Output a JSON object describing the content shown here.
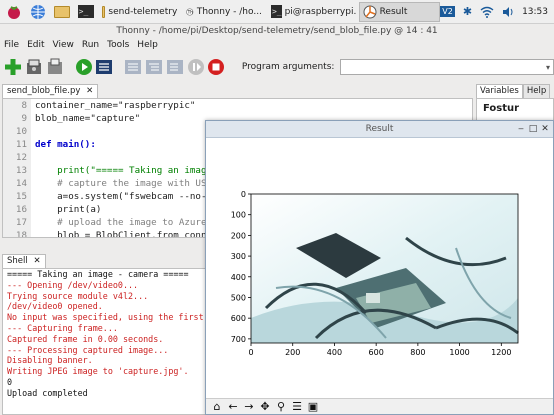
{
  "taskbar": {
    "tasks": [
      {
        "label": "send-telemetry"
      },
      {
        "label": "Thonny  - /ho..."
      },
      {
        "label": "pi@raspberrypi..."
      },
      {
        "label": "Result"
      }
    ],
    "clock": "13:53"
  },
  "window": {
    "title": "Thonny  -  /home/pi/Desktop/send-telemetry/send_blob_file.py  @  14 : 41"
  },
  "menu": {
    "items": [
      "File",
      "Edit",
      "View",
      "Run",
      "Tools",
      "Help"
    ]
  },
  "toolbar": {
    "program_args_label": "Program arguments:",
    "program_args_value": ""
  },
  "editor": {
    "tab": "send_blob_file.py",
    "line_numbers": [
      "8",
      "9",
      "10",
      "11",
      "12",
      "13",
      "14",
      "15",
      "16",
      "17",
      "18"
    ],
    "lines": [
      "container_name=\"raspberrypic\"",
      "blob_name=\"capture\"",
      "",
      "def main():",
      "",
      "    print(\"===== Taking an image",
      "    # capture the image with USB",
      "    a=os.system(\"fswebcam --no-b",
      "    print(a)",
      "    # upload the image to Azure",
      "    blob = BlobClient.from_conne"
    ]
  },
  "right_tabs": [
    "Variables",
    "Help"
  ],
  "right_panel_text": "Fostur",
  "shell": {
    "tab": "Shell",
    "lines": [
      {
        "t": "===== Taking an image - camera =====",
        "c": "blk"
      },
      {
        "t": "--- Opening /dev/video0...",
        "c": "red"
      },
      {
        "t": "Trying source module v4l2...",
        "c": "red"
      },
      {
        "t": "/dev/video0 opened.",
        "c": "red"
      },
      {
        "t": "No input was specified, using the first",
        "c": "red"
      },
      {
        "t": "--- Capturing frame...",
        "c": "red"
      },
      {
        "t": "Captured frame in 0.00 seconds.",
        "c": "red"
      },
      {
        "t": "--- Processing captured image...",
        "c": "red"
      },
      {
        "t": "Disabling banner.",
        "c": "red"
      },
      {
        "t": "Writing JPEG image to 'capture.jpg'.",
        "c": "red"
      },
      {
        "t": "0",
        "c": "blk"
      },
      {
        "t": "Upload completed",
        "c": "blk"
      }
    ]
  },
  "result": {
    "title": "Result",
    "xticks": [
      "0",
      "200",
      "400",
      "600",
      "800",
      "1000",
      "1200"
    ],
    "yticks": [
      "0",
      "100",
      "200",
      "300",
      "400",
      "500",
      "600",
      "700"
    ]
  },
  "chart_data": {
    "type": "image",
    "xlim": [
      0,
      1280
    ],
    "ylim": [
      720,
      0
    ]
  }
}
